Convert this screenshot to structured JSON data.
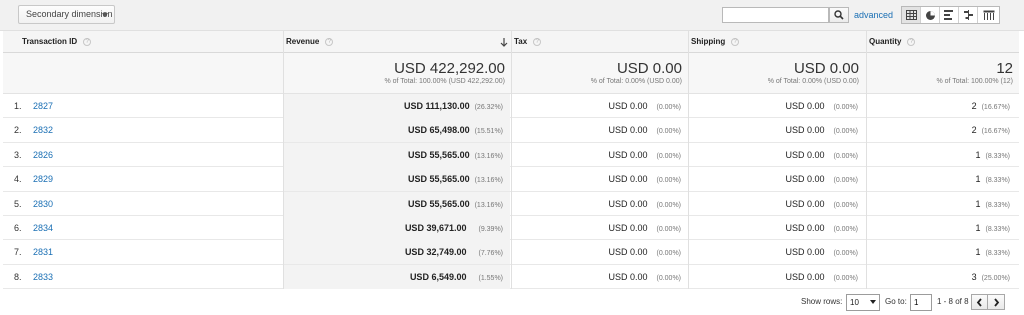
{
  "toolbar": {
    "secondary_dimension_label": "Secondary dimension",
    "search_value": "",
    "advanced_label": "advanced",
    "view_icons": [
      "table-view-icon",
      "pie-view-icon",
      "bar-view-icon",
      "comparison-view-icon",
      "pivot-view-icon"
    ]
  },
  "columns": {
    "transaction_id": "Transaction ID",
    "revenue": "Revenue",
    "tax": "Tax",
    "shipping": "Shipping",
    "quantity": "Quantity"
  },
  "totals": {
    "revenue": {
      "value": "USD 422,292.00",
      "sub": "% of Total: 100.00% (USD 422,292.00)"
    },
    "tax": {
      "value": "USD 0.00",
      "sub": "% of Total: 0.00% (USD 0.00)"
    },
    "shipping": {
      "value": "USD 0.00",
      "sub": "% of Total: 0.00% (USD 0.00)"
    },
    "quantity": {
      "value": "12",
      "sub": "% of Total: 100.00% (12)"
    }
  },
  "rows": [
    {
      "index": "1.",
      "id": "2827",
      "revenue": "USD 111,130.00",
      "revenue_pct": "(26.32%)",
      "tax": "USD 0.00",
      "tax_pct": "(0.00%)",
      "shipping": "USD 0.00",
      "shipping_pct": "(0.00%)",
      "quantity": "2",
      "quantity_pct": "(16.67%)"
    },
    {
      "index": "2.",
      "id": "2832",
      "revenue": "USD 65,498.00",
      "revenue_pct": "(15.51%)",
      "tax": "USD 0.00",
      "tax_pct": "(0.00%)",
      "shipping": "USD 0.00",
      "shipping_pct": "(0.00%)",
      "quantity": "2",
      "quantity_pct": "(16.67%)"
    },
    {
      "index": "3.",
      "id": "2826",
      "revenue": "USD 55,565.00",
      "revenue_pct": "(13.16%)",
      "tax": "USD 0.00",
      "tax_pct": "(0.00%)",
      "shipping": "USD 0.00",
      "shipping_pct": "(0.00%)",
      "quantity": "1",
      "quantity_pct": "(8.33%)"
    },
    {
      "index": "4.",
      "id": "2829",
      "revenue": "USD 55,565.00",
      "revenue_pct": "(13.16%)",
      "tax": "USD 0.00",
      "tax_pct": "(0.00%)",
      "shipping": "USD 0.00",
      "shipping_pct": "(0.00%)",
      "quantity": "1",
      "quantity_pct": "(8.33%)"
    },
    {
      "index": "5.",
      "id": "2830",
      "revenue": "USD 55,565.00",
      "revenue_pct": "(13.16%)",
      "tax": "USD 0.00",
      "tax_pct": "(0.00%)",
      "shipping": "USD 0.00",
      "shipping_pct": "(0.00%)",
      "quantity": "1",
      "quantity_pct": "(8.33%)"
    },
    {
      "index": "6.",
      "id": "2834",
      "revenue": "USD 39,671.00",
      "revenue_pct": "(9.39%)",
      "tax": "USD 0.00",
      "tax_pct": "(0.00%)",
      "shipping": "USD 0.00",
      "shipping_pct": "(0.00%)",
      "quantity": "1",
      "quantity_pct": "(8.33%)"
    },
    {
      "index": "7.",
      "id": "2831",
      "revenue": "USD 32,749.00",
      "revenue_pct": "(7.76%)",
      "tax": "USD 0.00",
      "tax_pct": "(0.00%)",
      "shipping": "USD 0.00",
      "shipping_pct": "(0.00%)",
      "quantity": "1",
      "quantity_pct": "(8.33%)"
    },
    {
      "index": "8.",
      "id": "2833",
      "revenue": "USD 6,549.00",
      "revenue_pct": "(1.55%)",
      "tax": "USD 0.00",
      "tax_pct": "(0.00%)",
      "shipping": "USD 0.00",
      "shipping_pct": "(0.00%)",
      "quantity": "3",
      "quantity_pct": "(25.00%)"
    }
  ],
  "footer": {
    "show_rows_label": "Show rows:",
    "show_rows_value": "10",
    "goto_label": "Go to:",
    "goto_value": "1",
    "range": "1 - 8 of 8"
  }
}
